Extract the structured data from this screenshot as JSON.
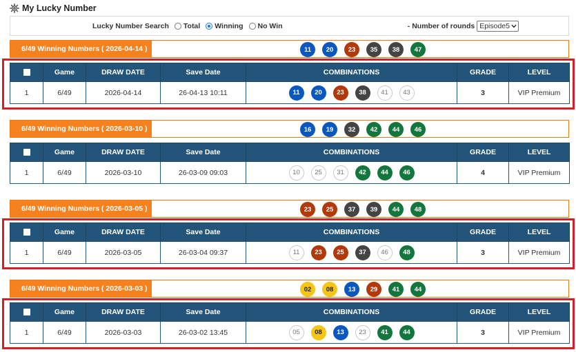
{
  "page": {
    "title": "My Lucky Number",
    "icon": "gear-icon"
  },
  "search": {
    "label": "Lucky Number Search",
    "options": [
      {
        "label": "Total",
        "checked": false
      },
      {
        "label": "Winning",
        "checked": true
      },
      {
        "label": "No Win",
        "checked": false
      }
    ],
    "rounds_label": "- Number of rounds",
    "rounds_value": "Episode5"
  },
  "table_headers": [
    "Game",
    "DRAW DATE",
    "Save Date",
    "COMBINATIONS",
    "GRADE",
    "LEVEL"
  ],
  "colors": {
    "orange": "#f6821f",
    "header_blue": "#23557a",
    "highlight_red": "#d32027"
  },
  "draws": [
    {
      "winning_label": "6/49 Winning Numbers ( 2026-04-14 )",
      "winning_numbers": [
        {
          "n": "11",
          "color": "blue"
        },
        {
          "n": "20",
          "color": "blue"
        },
        {
          "n": "23",
          "color": "red"
        },
        {
          "n": "35",
          "color": "dark"
        },
        {
          "n": "38",
          "color": "dark"
        },
        {
          "n": "47",
          "color": "green"
        }
      ],
      "highlighted": true,
      "row": {
        "no": "1",
        "game": "6/49",
        "draw_date": "2026-04-14",
        "save_date": "26-04-13 10:11",
        "combination": [
          {
            "n": "11",
            "color": "blue"
          },
          {
            "n": "20",
            "color": "blue"
          },
          {
            "n": "23",
            "color": "red"
          },
          {
            "n": "38",
            "color": "dark"
          },
          {
            "n": "41",
            "color": "plain"
          },
          {
            "n": "43",
            "color": "plain"
          }
        ],
        "grade": "3",
        "level": "VIP Premium"
      }
    },
    {
      "winning_label": "6/49 Winning Numbers ( 2026-03-10 )",
      "winning_numbers": [
        {
          "n": "16",
          "color": "blue"
        },
        {
          "n": "19",
          "color": "blue"
        },
        {
          "n": "32",
          "color": "dark"
        },
        {
          "n": "42",
          "color": "green"
        },
        {
          "n": "44",
          "color": "green"
        },
        {
          "n": "46",
          "color": "green"
        }
      ],
      "highlighted": false,
      "row": {
        "no": "1",
        "game": "6/49",
        "draw_date": "2026-03-10",
        "save_date": "26-03-09 09:03",
        "combination": [
          {
            "n": "10",
            "color": "plain"
          },
          {
            "n": "25",
            "color": "plain"
          },
          {
            "n": "31",
            "color": "plain"
          },
          {
            "n": "42",
            "color": "green"
          },
          {
            "n": "44",
            "color": "green"
          },
          {
            "n": "46",
            "color": "green"
          }
        ],
        "grade": "4",
        "level": "VIP Premium"
      }
    },
    {
      "winning_label": "6/49 Winning Numbers ( 2026-03-05 )",
      "winning_numbers": [
        {
          "n": "23",
          "color": "red"
        },
        {
          "n": "25",
          "color": "red"
        },
        {
          "n": "37",
          "color": "dark"
        },
        {
          "n": "39",
          "color": "dark"
        },
        {
          "n": "44",
          "color": "green"
        },
        {
          "n": "48",
          "color": "green"
        }
      ],
      "highlighted": true,
      "row": {
        "no": "1",
        "game": "6/49",
        "draw_date": "2026-03-05",
        "save_date": "26-03-04 09:37",
        "combination": [
          {
            "n": "11",
            "color": "plain"
          },
          {
            "n": "23",
            "color": "red"
          },
          {
            "n": "25",
            "color": "red"
          },
          {
            "n": "37",
            "color": "dark"
          },
          {
            "n": "46",
            "color": "plain"
          },
          {
            "n": "48",
            "color": "green"
          }
        ],
        "grade": "3",
        "level": "VIP Premium"
      }
    },
    {
      "winning_label": "6/49 Winning Numbers ( 2026-03-03 )",
      "winning_numbers": [
        {
          "n": "02",
          "color": "yellow"
        },
        {
          "n": "08",
          "color": "yellow"
        },
        {
          "n": "13",
          "color": "blue"
        },
        {
          "n": "29",
          "color": "red"
        },
        {
          "n": "41",
          "color": "green"
        },
        {
          "n": "44",
          "color": "green"
        }
      ],
      "highlighted": true,
      "row": {
        "no": "1",
        "game": "6/49",
        "draw_date": "2026-03-03",
        "save_date": "26-03-02 13:45",
        "combination": [
          {
            "n": "05",
            "color": "plain"
          },
          {
            "n": "08",
            "color": "yellow"
          },
          {
            "n": "13",
            "color": "blue"
          },
          {
            "n": "23",
            "color": "plain"
          },
          {
            "n": "41",
            "color": "green"
          },
          {
            "n": "44",
            "color": "green"
          }
        ],
        "grade": "3",
        "level": "VIP Premium"
      }
    }
  ]
}
